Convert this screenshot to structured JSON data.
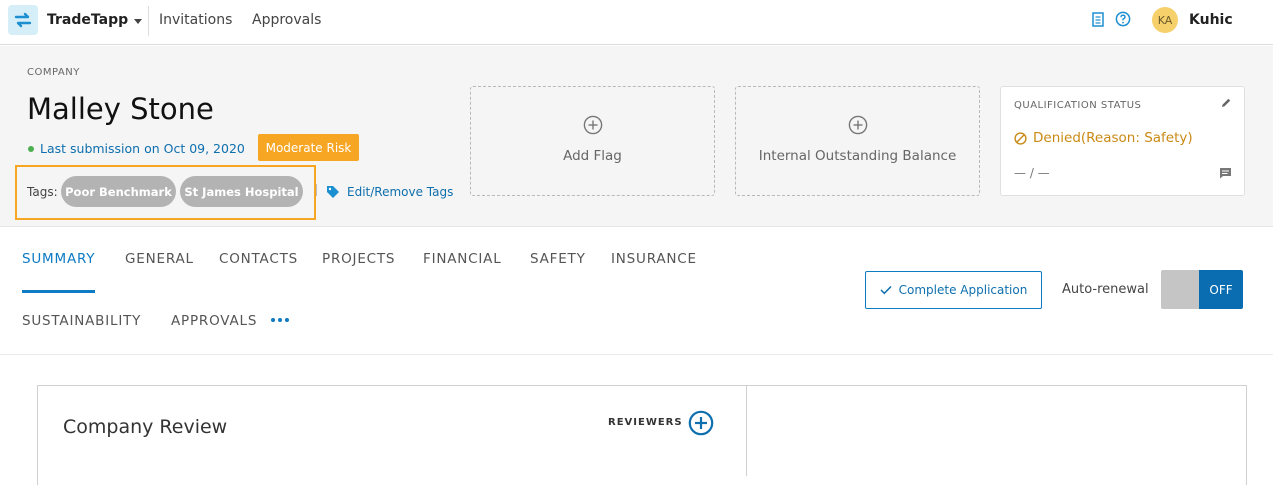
{
  "nav": {
    "app_name": "TradeTapp",
    "links": [
      "Invitations",
      "Approvals"
    ],
    "user_initials": "KA",
    "user_name": "Kuhic"
  },
  "company": {
    "label": "COMPANY",
    "name": "Malley Stone",
    "last_submission": "Last submission on Oct 09, 2020",
    "risk": "Moderate Risk",
    "tags_label": "Tags:",
    "tags": [
      "Poor Benchmark",
      "St James Hospital"
    ],
    "edit_tags": "Edit/Remove Tags"
  },
  "cards": {
    "add_flag": "Add Flag",
    "balance": "Internal Outstanding Balance"
  },
  "qualification": {
    "title": "QUALIFICATION STATUS",
    "status": "Denied(Reason: Safety)",
    "dates": "— / —"
  },
  "tabs": [
    "SUMMARY",
    "GENERAL",
    "CONTACTS",
    "PROJECTS",
    "FINANCIAL",
    "SAFETY",
    "INSURANCE",
    "SUSTAINABILITY",
    "APPROVALS"
  ],
  "actions": {
    "complete_application": "Complete Application",
    "auto_renewal_label": "Auto-renewal",
    "auto_renewal_state": "OFF"
  },
  "review": {
    "title": "Company Review",
    "reviewers_label": "REVIEWERS"
  },
  "colors": {
    "accent": "#0e7bc4",
    "risk": "#f7a623",
    "denied": "#c98a15",
    "tag_bg": "#b3b3b3"
  }
}
